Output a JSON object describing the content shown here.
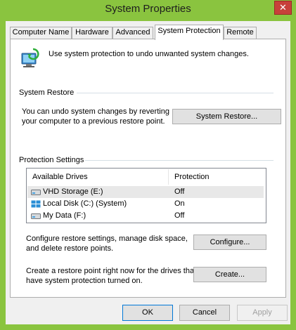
{
  "window": {
    "title": "System Properties",
    "close_glyph": "✕"
  },
  "tabs": [
    {
      "label": "Computer Name"
    },
    {
      "label": "Hardware"
    },
    {
      "label": "Advanced"
    },
    {
      "label": "System Protection"
    },
    {
      "label": "Remote"
    }
  ],
  "intro": {
    "text": "Use system protection to undo unwanted system changes.",
    "icon": "system-protection-icon"
  },
  "system_restore": {
    "group_label": "System Restore",
    "description_line1": "You can undo system changes by reverting",
    "description_line2": "your computer to a previous restore point.",
    "button_label": "System Restore..."
  },
  "protection": {
    "group_label": "Protection Settings",
    "columns": [
      "Available Drives",
      "Protection"
    ],
    "drives": [
      {
        "name": "VHD Storage (E:)",
        "protection": "Off",
        "icon": "drive-icon"
      },
      {
        "name": "Local Disk (C:) (System)",
        "protection": "On",
        "icon": "windows-drive-icon"
      },
      {
        "name": "My Data (F:)",
        "protection": "Off",
        "icon": "drive-icon"
      }
    ],
    "configure_text_line1": "Configure restore settings, manage disk space,",
    "configure_text_line2": "and delete restore points.",
    "configure_button": "Configure...",
    "create_text_line1": "Create a restore point right now for the drives that",
    "create_text_line2": "have system protection turned on.",
    "create_button": "Create..."
  },
  "footer": {
    "ok": "OK",
    "cancel": "Cancel",
    "apply": "Apply"
  },
  "colors": {
    "frame": "#8ac43f",
    "close_button": "#c7403a",
    "default_button_border": "#0078d7"
  }
}
